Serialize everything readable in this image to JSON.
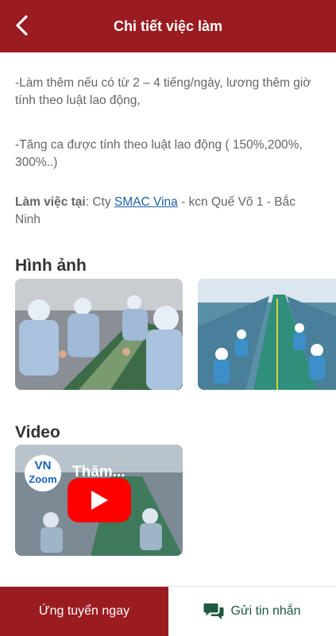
{
  "header": {
    "title": "Chi tiết việc làm"
  },
  "details": {
    "para1": "-Làm thêm nếu có từ 2 – 4 tiếng/ngày, lương thêm giờ tính theo luật lao động,",
    "para2": "-Tăng ca được tính theo luật lao động ( 150%,200%, 300%..)",
    "workplace_label": "Làm việc tại",
    "workplace_prefix": ": Cty ",
    "workplace_link": "SMAC Vina",
    "workplace_suffix": " - kcn Quế Võ 1 - Bắc Ninh"
  },
  "images_section": {
    "title": "Hình ảnh"
  },
  "video_section": {
    "title": "Video",
    "channel_logo_line1": "VN",
    "channel_logo_line2": "Zoom",
    "video_title": "Thăm..."
  },
  "footer": {
    "apply_label": "Ứng tuyển ngay",
    "message_label": "Gửi tin nhắn"
  },
  "colors": {
    "brand": "#9b1c20",
    "message": "#1d5a3e",
    "link": "#1f5fa8"
  },
  "icons": {
    "back": "chevron-left-icon",
    "message": "chat-bubbles-icon",
    "play": "youtube-play-icon"
  }
}
